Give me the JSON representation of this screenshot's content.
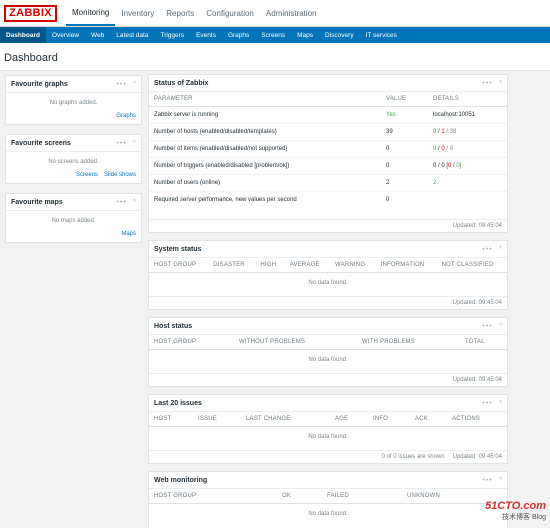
{
  "logo": "ZABBIX",
  "main_menu": [
    "Monitoring",
    "Inventory",
    "Reports",
    "Configuration",
    "Administration"
  ],
  "sub_menu": [
    "Dashboard",
    "Overview",
    "Web",
    "Latest data",
    "Triggers",
    "Events",
    "Graphs",
    "Screens",
    "Maps",
    "Discovery",
    "IT services"
  ],
  "page_title": "Dashboard",
  "fav_graphs": {
    "title": "Favourite graphs",
    "empty": "No graphs added.",
    "link": "Graphs"
  },
  "fav_screens": {
    "title": "Favourite screens",
    "empty": "No screens added.",
    "link1": "Screens",
    "link2": "Slide shows"
  },
  "fav_maps": {
    "title": "Favourite maps",
    "empty": "No maps added.",
    "link": "Maps"
  },
  "ctrl": {
    "dots": "•••",
    "chevron": "^"
  },
  "status": {
    "title": "Status of Zabbix",
    "headers": [
      "PARAMETER",
      "VALUE",
      "DETAILS"
    ],
    "rows": [
      {
        "param": "Zabbix server is running",
        "value": "Yes",
        "d1": "localhost:10051",
        "d2": "",
        "d3": "",
        "d4": ""
      },
      {
        "param": "Number of hosts (enabled/disabled/templates)",
        "value": "39",
        "d1": "0",
        "d2": " / ",
        "d3": "1",
        "d4": " / 38"
      },
      {
        "param": "Number of items (enabled/disabled/not supported)",
        "value": "0",
        "d1": "0",
        "d2": " / ",
        "d3": "0",
        "d4": " / 0"
      },
      {
        "param": "Number of triggers (enabled/disabled [problem/ok])",
        "value": "0",
        "d1": "0 / 0 [",
        "d2": "0",
        "d3": " / ",
        "d4": "0]"
      },
      {
        "param": "Number of users (online)",
        "value": "2",
        "d1": "2",
        "d2": "",
        "d3": "",
        "d4": ""
      },
      {
        "param": "Required server performance, new values per second",
        "value": "0",
        "d1": "",
        "d2": "",
        "d3": "",
        "d4": ""
      }
    ],
    "updated": "Updated: 09:45:04"
  },
  "system_status": {
    "title": "System status",
    "headers": [
      "HOST GROUP",
      "DISASTER",
      "HIGH",
      "AVERAGE",
      "WARNING",
      "INFORMATION",
      "NOT CLASSIFIED"
    ],
    "empty": "No data found.",
    "updated": "Updated: 09:45:04"
  },
  "host_status": {
    "title": "Host status",
    "headers": [
      "HOST GROUP",
      "WITHOUT PROBLEMS",
      "WITH PROBLEMS",
      "TOTAL"
    ],
    "empty": "No data found.",
    "updated": "Updated: 09:45:04"
  },
  "last_issues": {
    "title": "Last 20 issues",
    "headers": [
      "HOST",
      "ISSUE",
      "LAST CHANGE",
      "AGE",
      "INFO",
      "ACK",
      "ACTIONS"
    ],
    "empty": "No data found.",
    "shown": "0 of 0 issues are shown",
    "updated": "Updated: 09:45:04"
  },
  "web_monitoring": {
    "title": "Web monitoring",
    "headers": [
      "HOST GROUP",
      "OK",
      "FAILED",
      "UNKNOWN"
    ],
    "empty": "No data found."
  },
  "watermark": {
    "line1": "51CTO.com",
    "line2": "技术博客 Blog"
  }
}
